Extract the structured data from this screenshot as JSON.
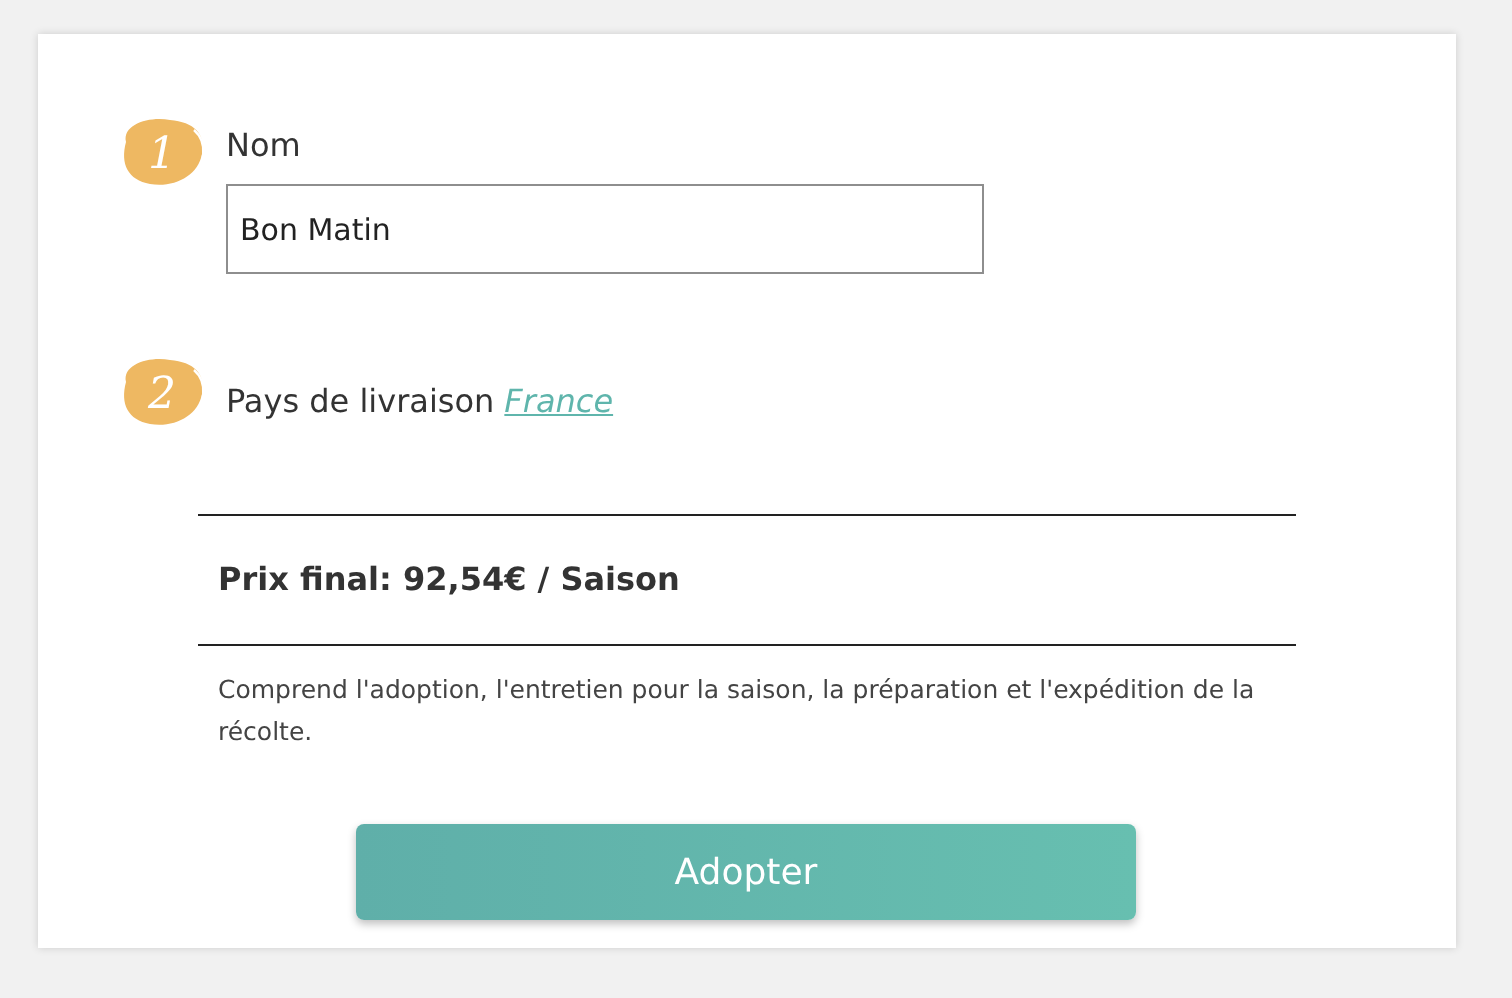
{
  "steps": [
    {
      "number": "1",
      "kind": "text_field",
      "label": "Nom",
      "value": "Bon Matin"
    },
    {
      "number": "2",
      "kind": "link_choice",
      "label": "Pays de livraison",
      "link": "France"
    }
  ],
  "price": "Prix final: 92,54€ / Saison",
  "description": "Comprend l'adoption, l'entretien pour la saison, la préparation et l'expédition de la récolte.",
  "button": "Adopter"
}
